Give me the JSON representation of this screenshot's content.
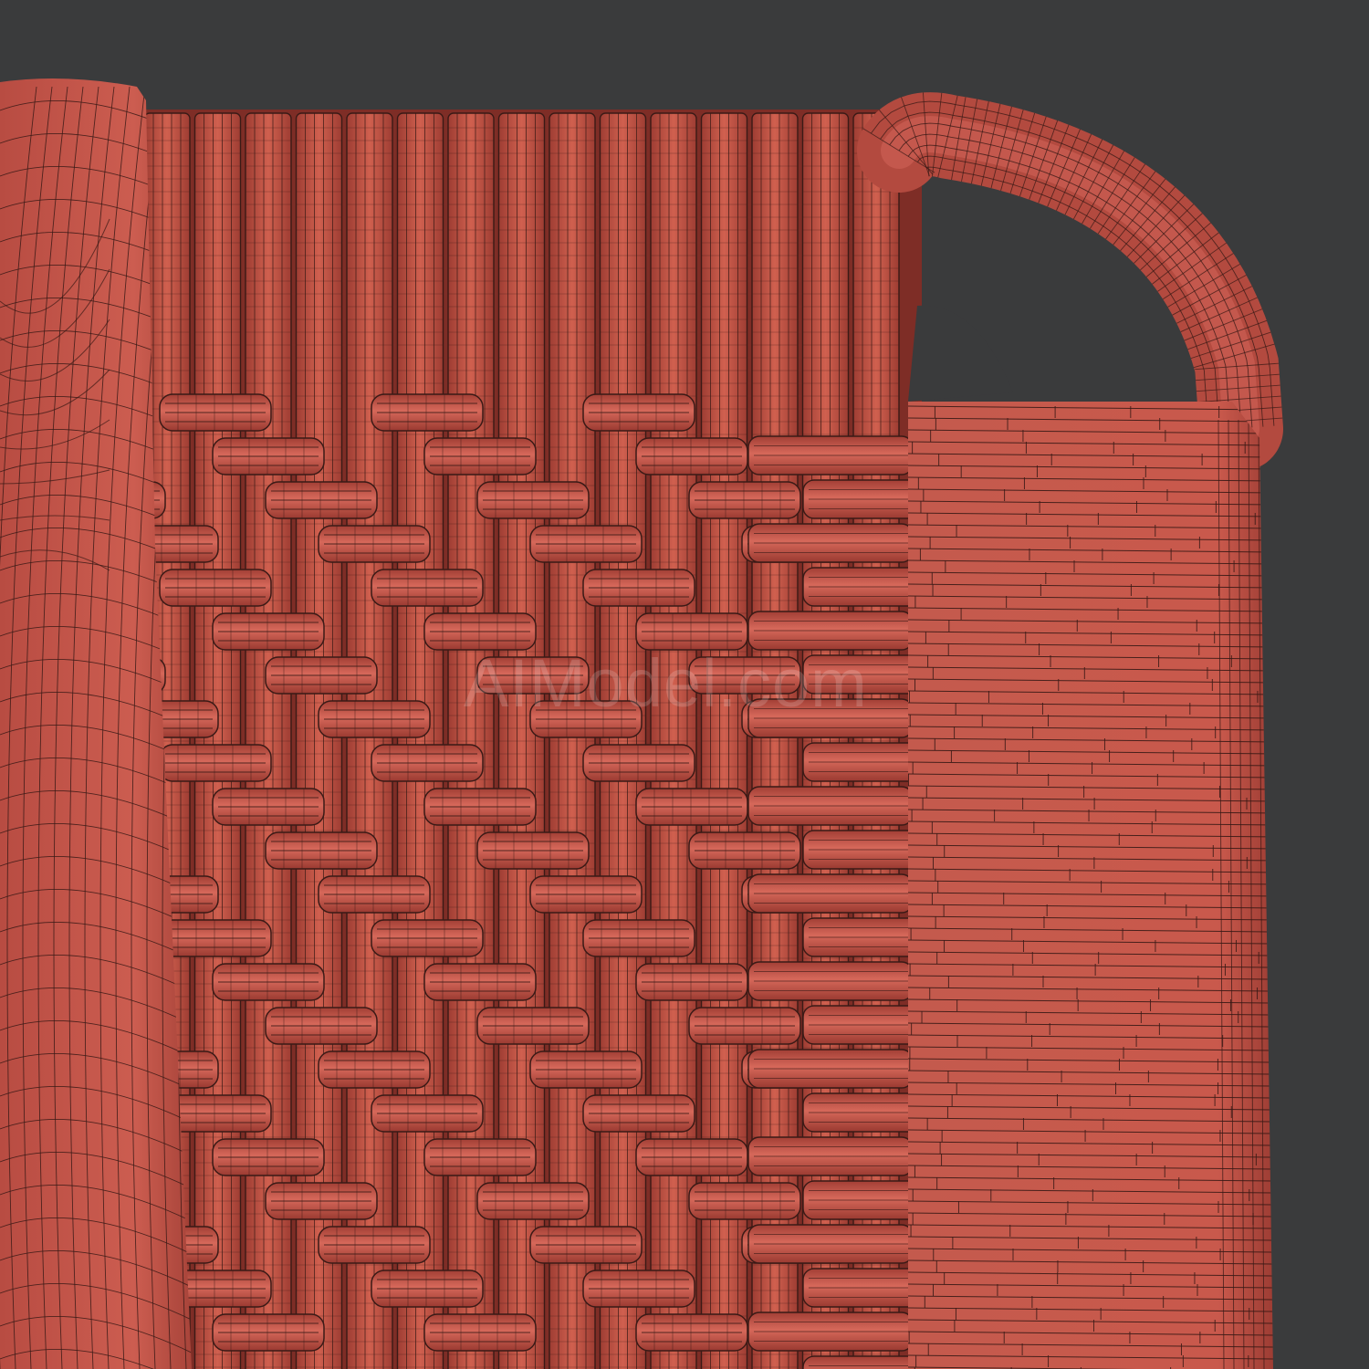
{
  "render": {
    "background_color": "#3a3b3c",
    "surface_color": "#c8564b",
    "surface_shadow_color": "#a84238",
    "surface_highlight_color": "#d8695c",
    "wire_color": "#3a1a16"
  },
  "scene": {
    "subject": "wicker-weave-wireframe",
    "elements": [
      "cushion",
      "woven-backrest",
      "rounded-frame",
      "wrapped-side-panel"
    ]
  },
  "watermark": {
    "text": "AIModel.com"
  }
}
